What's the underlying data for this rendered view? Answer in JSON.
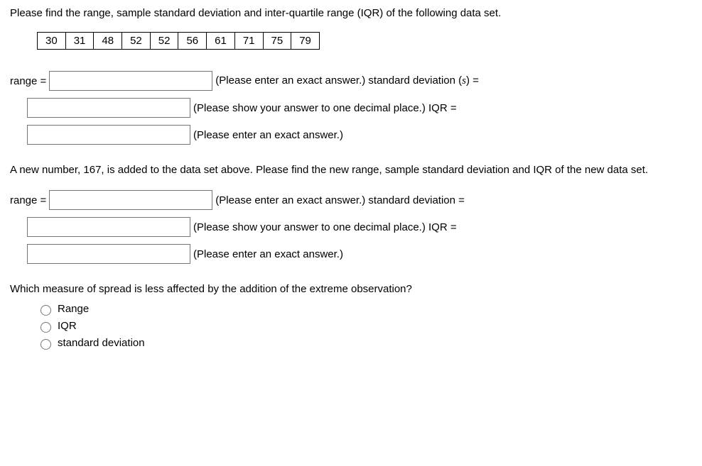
{
  "intro": "Please find the range, sample standard deviation and inter-quartile range (IQR) of the following data set.",
  "data_values": [
    "30",
    "31",
    "48",
    "52",
    "52",
    "56",
    "61",
    "71",
    "75",
    "79"
  ],
  "q1": {
    "range_label": "range =",
    "range_hint": "(Please enter an exact answer.) standard deviation (",
    "s_var": "s",
    "range_hint_tail": ") =",
    "sd_hint": "(Please show your answer to one decimal place.) IQR =",
    "iqr_hint": "(Please enter an exact answer.)"
  },
  "mid_prompt": "A new number, 167, is added to the data set above. Please find the new range, sample standard deviation and IQR of the new data set.",
  "q2": {
    "range_label": "range =",
    "range_hint": "(Please enter an exact answer.) standard deviation =",
    "sd_hint": "(Please show your answer to one decimal place.) IQR =",
    "iqr_hint": "(Please enter an exact answer.)"
  },
  "final_prompt": "Which measure of spread is less affected by the addition of the extreme observation?",
  "options": {
    "range": "Range",
    "iqr": "IQR",
    "sd": "standard deviation"
  }
}
